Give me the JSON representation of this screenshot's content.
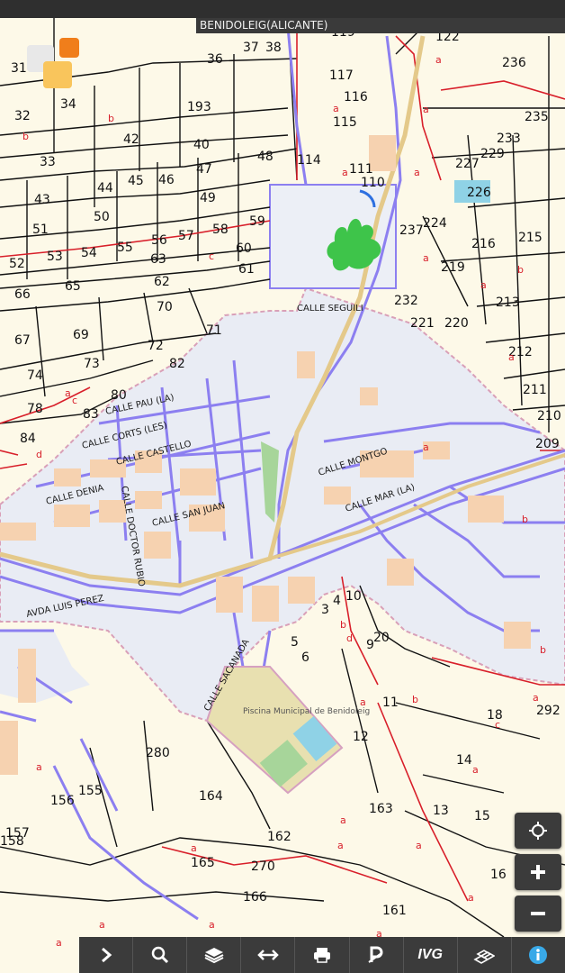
{
  "header": {
    "title": "BENIDOLEIG(ALICANTE)"
  },
  "map": {
    "streets": [
      "CALLE SEGUILI",
      "CALLE PAU (LA)",
      "CALLE CORTS (LES)",
      "CALLE CASTELLO",
      "CALLE DENIA",
      "CALLE DOCTOR RUBIO",
      "CALLE SAN JUAN",
      "CALLE MONTGO",
      "CALLE MAR (LA)",
      "AVDA LUIS PEREZ",
      "CALLE SACANADA"
    ],
    "pois": [
      "Piscina Municipal de Benidoleig"
    ],
    "parcels": [
      "122",
      "119",
      "117",
      "116",
      "115",
      "36",
      "37",
      "38",
      "193",
      "42",
      "40",
      "48",
      "33",
      "34",
      "32",
      "31",
      "47",
      "44",
      "45",
      "46",
      "43",
      "49",
      "51",
      "50",
      "53",
      "54",
      "55",
      "56",
      "57",
      "58",
      "59",
      "52",
      "60",
      "61",
      "63",
      "62",
      "65",
      "66",
      "70",
      "71",
      "72",
      "67",
      "69",
      "73",
      "74",
      "80",
      "82",
      "78",
      "83",
      "84",
      "110",
      "114",
      "111",
      "226",
      "227",
      "229",
      "233",
      "235",
      "236",
      "224",
      "237",
      "216",
      "215",
      "219",
      "232",
      "221",
      "220",
      "213",
      "212",
      "211",
      "210",
      "209",
      "10",
      "3",
      "4",
      "9",
      "20",
      "5",
      "6",
      "11",
      "12",
      "18",
      "14",
      "13",
      "15",
      "292",
      "280",
      "156",
      "155",
      "157",
      "158",
      "164",
      "163",
      "162",
      "165",
      "270",
      "166",
      "161",
      "16"
    ],
    "letters": [
      "a",
      "b",
      "c",
      "d"
    ],
    "colors": {
      "background": "#fdf9e8",
      "urban_fill": "#e9ecf4",
      "street_outline": "#8c7ff0",
      "main_road": "#e4c98a",
      "parcel_line": "#111111",
      "cadastral_red": "#d81f2a",
      "vegetation": "#3ec44a",
      "pool": "#8fd2e6",
      "building": "#f6d2b0"
    }
  },
  "controls": {
    "locate_icon": "crosshair-icon",
    "zoom_in_icon": "plus-icon",
    "zoom_out_icon": "minus-icon"
  },
  "toolbar": {
    "items": [
      "chevron-right-icon",
      "search-icon",
      "layers-icon",
      "measure-arrows-icon",
      "print-icon",
      "parking-icon",
      "ivg-label",
      "cadastre-icon",
      "info-icon"
    ],
    "ivg_label": "IVG"
  }
}
